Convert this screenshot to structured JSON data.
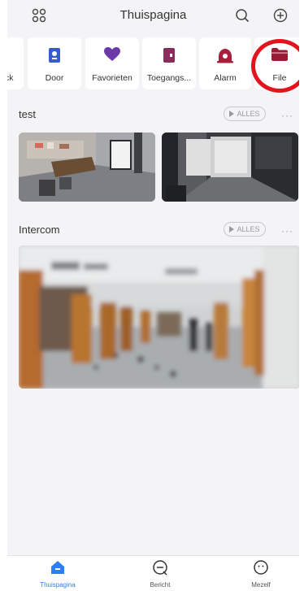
{
  "header": {
    "title": "Thuispagina",
    "left_icon": "apps-grid-icon",
    "search_icon": "search-icon",
    "add_icon": "add-circle-icon"
  },
  "quick_access": [
    {
      "label": "ck",
      "icon": "lock-icon"
    },
    {
      "label": "Door",
      "icon": "door-panel-icon",
      "color": "#3a5bd0"
    },
    {
      "label": "Favorieten",
      "icon": "heart-icon",
      "color": "#6b39a8"
    },
    {
      "label": "Toegangs...",
      "icon": "access-control-icon",
      "color": "#8a2d5e"
    },
    {
      "label": "Alarm",
      "icon": "alarm-icon",
      "color": "#a81f3d"
    },
    {
      "label": "File",
      "icon": "folder-icon",
      "color": "#9b1b34"
    }
  ],
  "sections": [
    {
      "title": "test",
      "button": "ALLES",
      "more": "···"
    },
    {
      "title": "Intercom",
      "button": "ALLES",
      "more": "···"
    }
  ],
  "tabs": [
    {
      "label": "Thuispagina",
      "icon": "home-icon",
      "active": true
    },
    {
      "label": "Bericht",
      "icon": "message-icon",
      "active": false
    },
    {
      "label": "Mezelf",
      "icon": "profile-icon",
      "active": false
    }
  ],
  "colors": {
    "accent": "#2d7ff9",
    "highlight_circle": "#e3141d"
  }
}
